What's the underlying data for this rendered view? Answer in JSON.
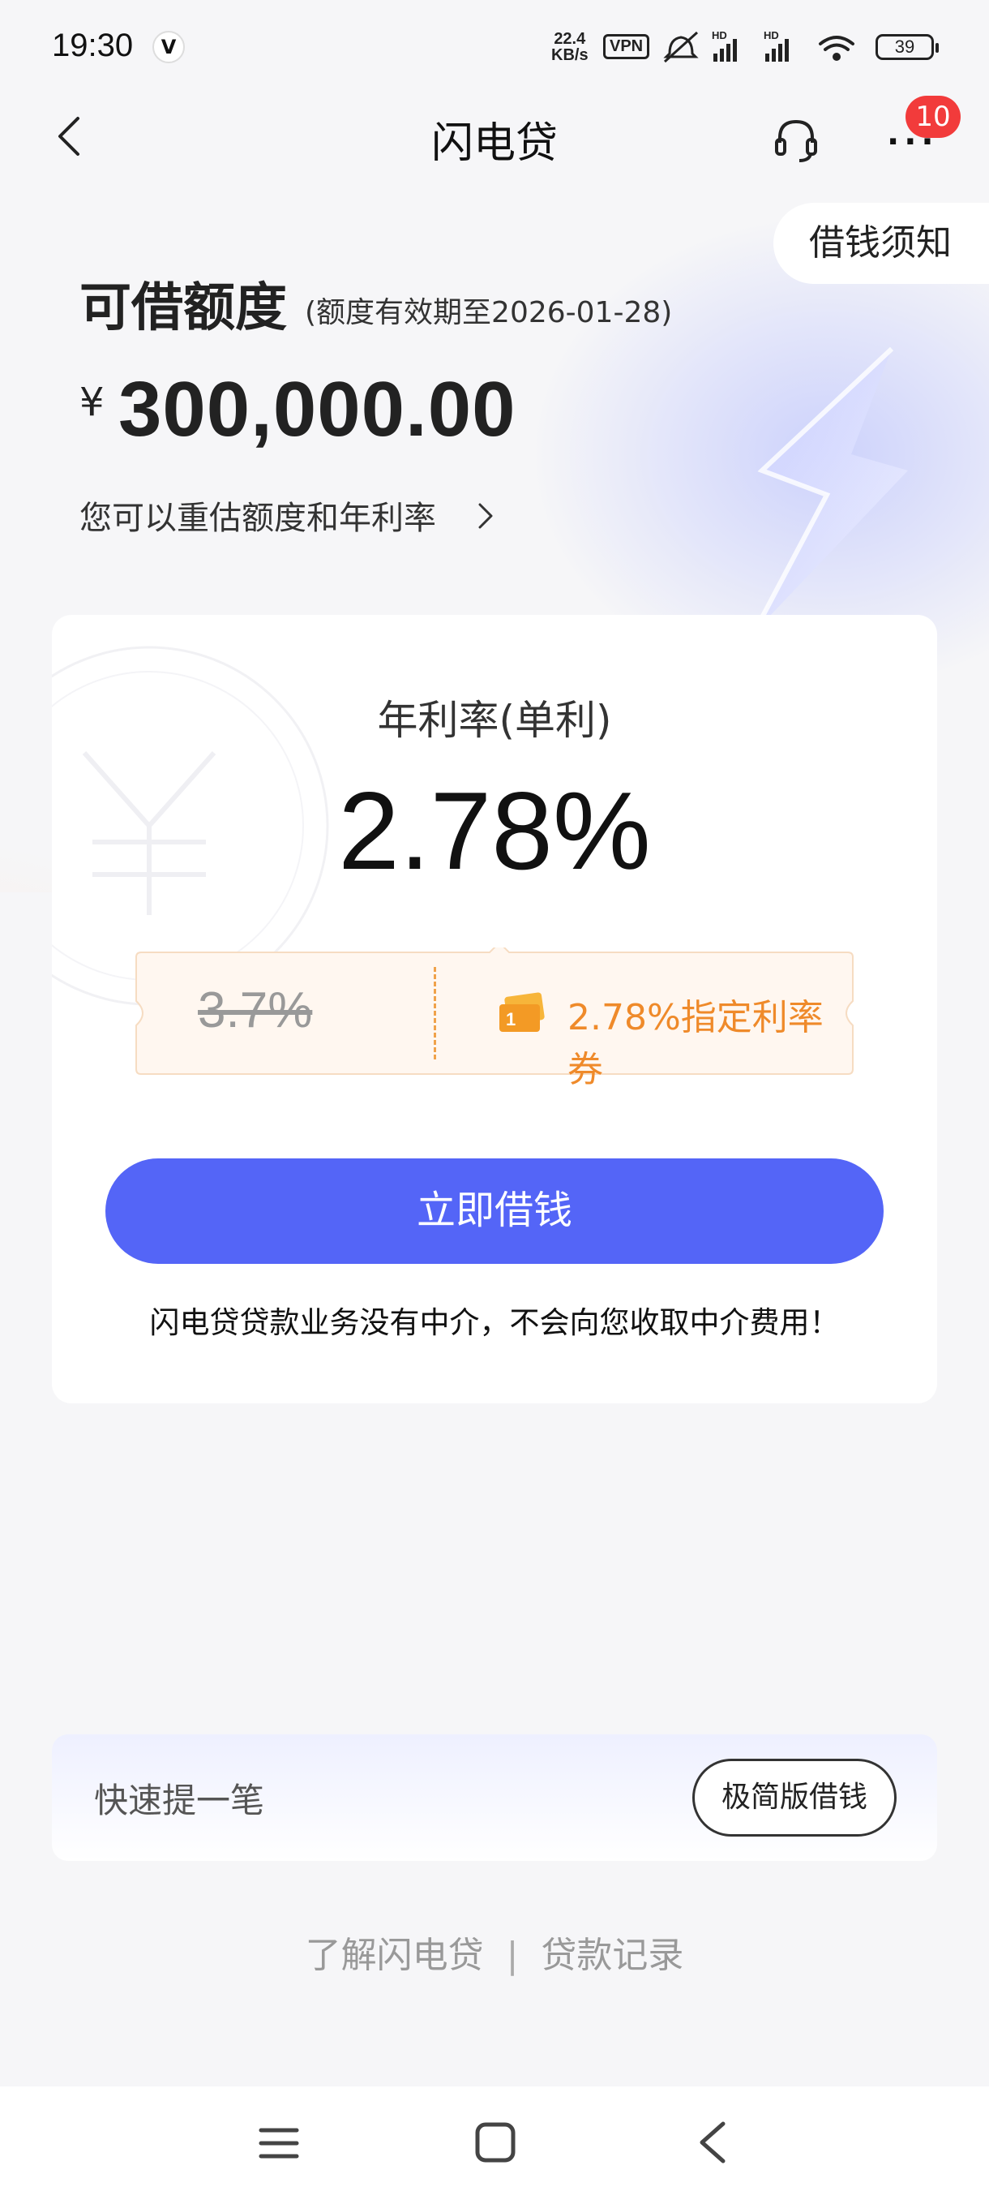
{
  "status_bar": {
    "time": "19:30",
    "badge": "V",
    "net_speed_value": "22.4",
    "net_speed_unit": "KB/s",
    "vpn": "VPN",
    "battery": "39"
  },
  "nav": {
    "title": "闪电贷",
    "notification_count": "10"
  },
  "notice_tab": "借钱须知",
  "credit": {
    "title": "可借额度",
    "validity": "(额度有效期至2026-01-28)",
    "currency": "¥",
    "amount": "300,000.00",
    "reassess_text": "您可以重估额度和年利率"
  },
  "rate_card": {
    "label": "年利率(单利)",
    "value": "2.78%",
    "old_rate": "3.7%",
    "coupon_text": "2.78%指定利率券",
    "borrow_button": "立即借钱",
    "disclaimer": "闪电贷贷款业务没有中介，不会向您收取中介费用！"
  },
  "quick": {
    "label": "快速提一笔",
    "simple_button": "极简版借钱"
  },
  "footer": {
    "link_about": "了解闪电贷",
    "separator": "|",
    "link_records": "贷款记录"
  },
  "colors": {
    "primary": "#5465f7",
    "coupon_orange": "#ef8a2a",
    "badge_red": "#f23b3b"
  }
}
